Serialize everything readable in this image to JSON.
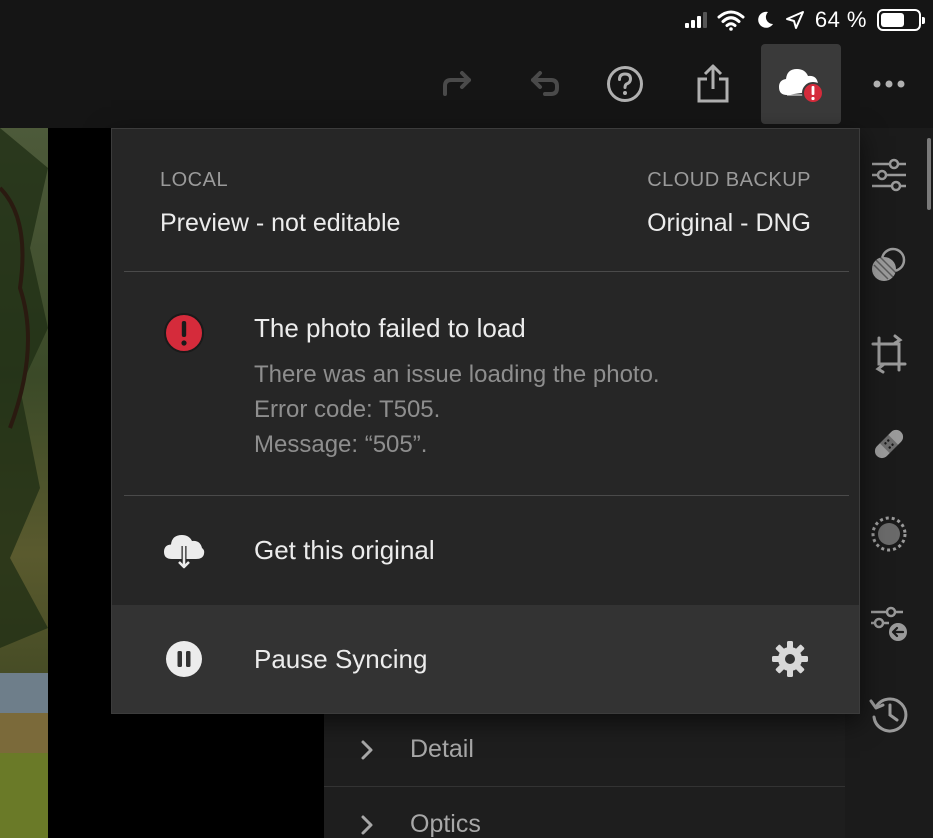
{
  "status_bar": {
    "battery_percent": "64 %",
    "battery_level": 0.64
  },
  "toolbar": {
    "buttons": [
      {
        "name": "redo-icon"
      },
      {
        "name": "undo-icon"
      },
      {
        "name": "help-icon"
      },
      {
        "name": "share-icon"
      },
      {
        "name": "cloud-error-icon",
        "active": true
      },
      {
        "name": "more-icon"
      }
    ]
  },
  "popover": {
    "local_label": "LOCAL",
    "local_value": "Preview - not editable",
    "cloud_label": "CLOUD BACKUP",
    "cloud_value": "Original - DNG",
    "error": {
      "title": "The photo failed to load",
      "line1": "There was an issue loading the photo.",
      "line2": "Error code: T505.",
      "line3": "Message: “505”."
    },
    "get_original_label": "Get this original",
    "pause_label": "Pause Syncing"
  },
  "edit_panel": {
    "items": [
      {
        "label": "Detail"
      },
      {
        "label": "Optics"
      }
    ]
  },
  "tools_panel": {
    "tools": [
      "adjust-sliders-icon",
      "presets-icon",
      "crop-icon",
      "healing-icon",
      "masking-icon",
      "versions-icon",
      "history-icon"
    ]
  },
  "colors": {
    "error_red": "#d52b3b",
    "background": "#151515",
    "popover_bg": "#262626"
  }
}
